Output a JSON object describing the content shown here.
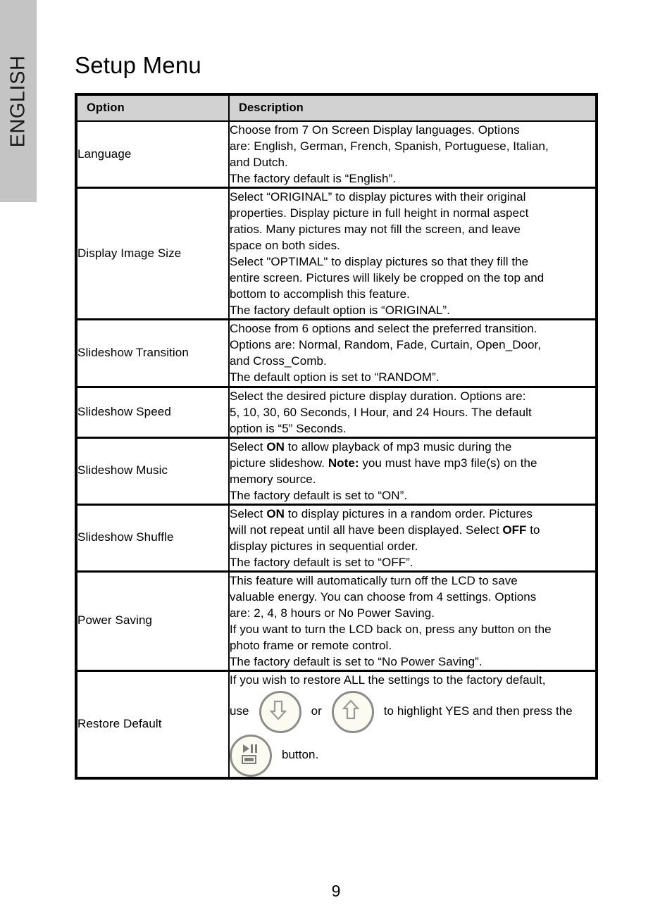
{
  "sidebar": {
    "language_tab_label": "ENGLISH"
  },
  "page": {
    "title": "Setup Menu",
    "page_number": "9"
  },
  "table": {
    "columns": {
      "option_header": "Option",
      "description_header": "Description"
    },
    "rows": [
      {
        "option": "Language",
        "description_lines": [
          "Choose from 7 On Screen Display languages.  Options",
          "are: English, German, French, Spanish, Portuguese, Italian,",
          "and Dutch.",
          "The factory default is “English”."
        ]
      },
      {
        "option": "Display Image Size",
        "description_lines": [
          "Select “ORIGINAL” to display pictures with their original",
          "properties.  Display picture in full height in normal aspect",
          "ratios.  Many pictures may not fill the screen, and leave",
          "space on both sides.",
          "Select \"OPTIMAL\" to display pictures so that they fill the",
          "entire screen.  Pictures will likely be cropped on the top and",
          "bottom to accomplish this feature.",
          "The factory default option is “ORIGINAL”."
        ]
      },
      {
        "option": "Slideshow Transition",
        "description_lines": [
          "Choose from 6 options and select the preferred transition.",
          "Options are: Normal, Random, Fade, Curtain, Open_Door,",
          "and Cross_Comb.",
          "The default option is set to “RANDOM”."
        ]
      },
      {
        "option": "Slideshow Speed",
        "description_lines": [
          "Select the desired picture display duration.  Options are:",
          "5, 10, 30, 60 Seconds, I Hour, and 24 Hours. The default",
          "option is “5” Seconds."
        ]
      },
      {
        "option": "Slideshow Music",
        "description_rich": [
          [
            {
              "t": "Select ",
              "b": false
            },
            {
              "t": "ON",
              "b": true
            },
            {
              "t": " to allow playback of mp3 music during the",
              "b": false
            }
          ],
          [
            {
              "t": "picture slideshow.  ",
              "b": false
            },
            {
              "t": "Note:",
              "b": true
            },
            {
              "t": " you must have mp3 file(s) on the",
              "b": false
            }
          ],
          [
            {
              "t": "memory source.",
              "b": false
            }
          ],
          [
            {
              "t": "The factory default is set to “ON”.",
              "b": false
            }
          ]
        ]
      },
      {
        "option": "Slideshow Shuffle",
        "description_rich": [
          [
            {
              "t": "Select ",
              "b": false
            },
            {
              "t": "ON",
              "b": true
            },
            {
              "t": " to display pictures in a random order.  Pictures",
              "b": false
            }
          ],
          [
            {
              "t": "will not repeat until all have been displayed.  Select ",
              "b": false
            },
            {
              "t": "OFF",
              "b": true
            },
            {
              "t": " to",
              "b": false
            }
          ],
          [
            {
              "t": "display pictures in sequential order.",
              "b": false
            }
          ],
          [
            {
              "t": "The factory default is set to “OFF”.",
              "b": false
            }
          ]
        ]
      },
      {
        "option": "Power Saving",
        "description_lines": [
          "This feature will automatically turn off the LCD to save",
          "valuable energy.  You can choose from 4 settings. Options",
          "are: 2, 4, 8 hours or No Power Saving.",
          "If you want to turn the LCD back on, press any button on the",
          "photo frame or remote control.",
          "The factory default is set to “No Power Saving”."
        ]
      },
      {
        "option": "Restore Default",
        "restore": {
          "line1": "If you wish to restore ALL the settings to the factory default,",
          "word_use": "use",
          "word_or": "or",
          "after_icons": "to highlight YES and then press the",
          "word_button": "button.",
          "icons": {
            "down": "arrow-down-button-icon",
            "up": "arrow-up-button-icon",
            "play": "play-pause-stop-button-icon"
          }
        }
      }
    ]
  },
  "colors": {
    "tab_background": "#c4c4c4",
    "header_background": "#d2d2d2",
    "border": "#000000",
    "icon_ring": "#8d8d88",
    "icon_fill": "#fbfbf2"
  }
}
